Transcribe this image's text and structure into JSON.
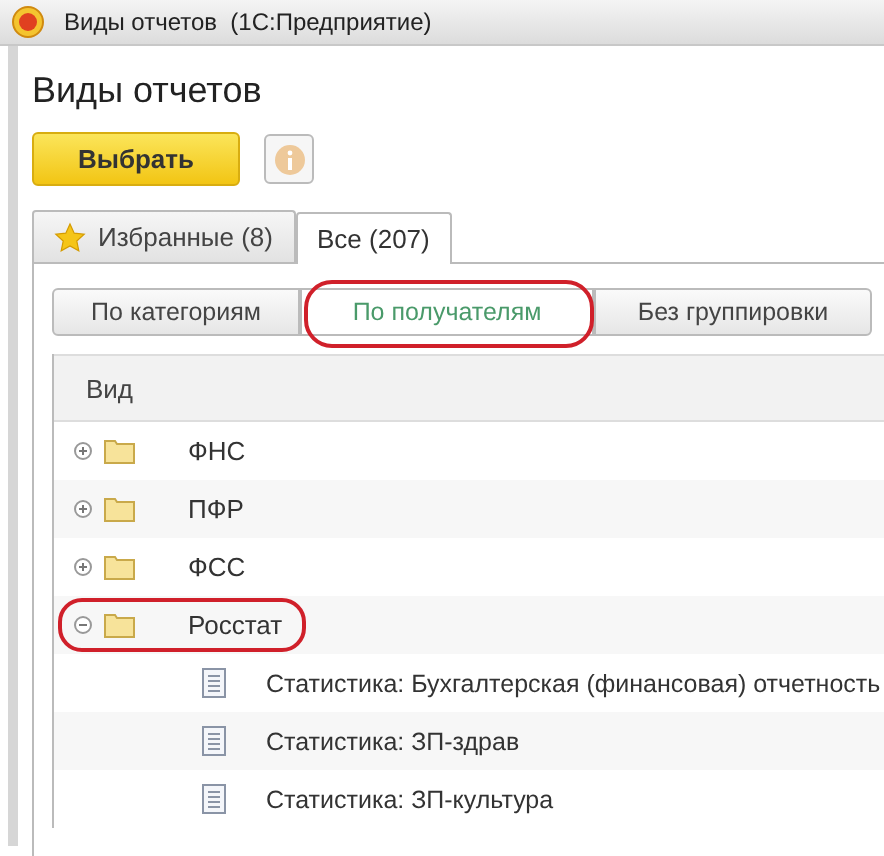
{
  "window": {
    "title": "Виды отчетов  (1С:Предприятие)"
  },
  "heading": "Виды отчетов",
  "toolbar": {
    "select_button": "Выбрать"
  },
  "tabs": [
    {
      "label": "Избранные (8)",
      "selected": false,
      "kind": "favorites"
    },
    {
      "label": "Все (207)",
      "selected": true,
      "kind": "plain"
    }
  ],
  "grouping": [
    {
      "label": "По категориям",
      "selected": false,
      "highlighted": false
    },
    {
      "label": "По получателям",
      "selected": true,
      "highlighted": true
    },
    {
      "label": "Без группировки",
      "selected": false,
      "highlighted": false
    }
  ],
  "table": {
    "columns": [
      "Вид"
    ],
    "rows": [
      {
        "name": "ФНС",
        "kind": "folder",
        "expanded": false,
        "highlighted": false
      },
      {
        "name": "ПФР",
        "kind": "folder",
        "expanded": false,
        "highlighted": false
      },
      {
        "name": "ФСС",
        "kind": "folder",
        "expanded": false,
        "highlighted": false
      },
      {
        "name": "Росстат",
        "kind": "folder",
        "expanded": true,
        "highlighted": true,
        "children": [
          {
            "name": "Статистика: Бухгалтерская (финансовая) отчетность",
            "kind": "document"
          },
          {
            "name": "Статистика: ЗП-здрав",
            "kind": "document"
          },
          {
            "name": "Статистика: ЗП-культура",
            "kind": "document"
          }
        ]
      }
    ]
  }
}
